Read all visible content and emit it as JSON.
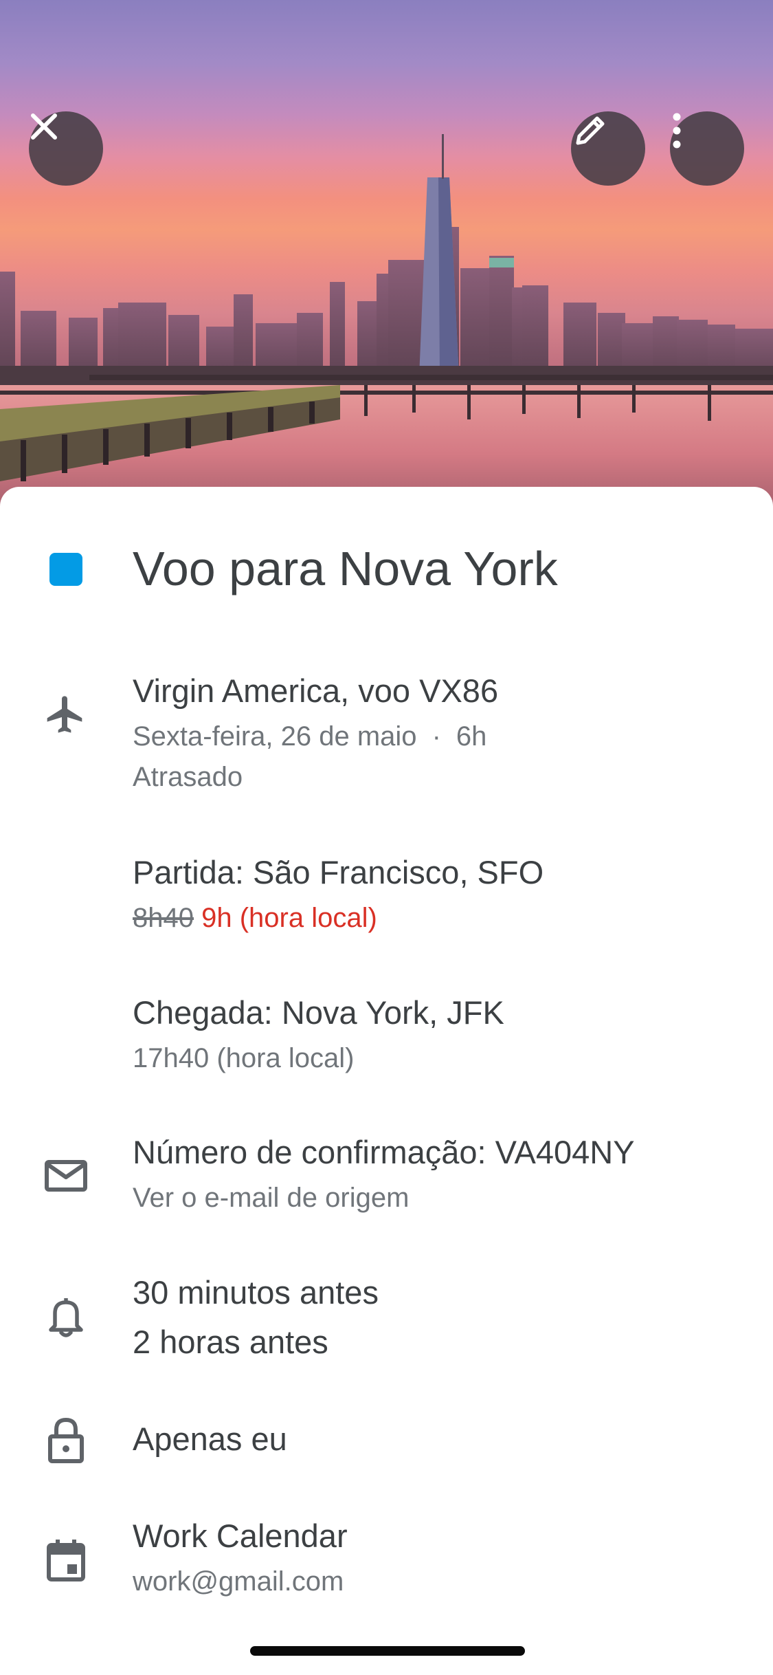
{
  "event": {
    "title": "Voo para Nova York",
    "calendar_color": "#039be5"
  },
  "flight": {
    "airline_line": "Virgin America, voo VX86",
    "date": "Sexta-feira, 26 de maio",
    "duration": "6h",
    "status": "Atrasado"
  },
  "departure": {
    "label": "Partida: São Francisco, SFO",
    "original_time": "8h40",
    "new_time": "9h (hora local)",
    "delay_color": "#d93025"
  },
  "arrival": {
    "label": "Chegada: Nova York, JFK",
    "time": "17h40 (hora local)"
  },
  "confirmation": {
    "label": "Número de confirmação: VA404NY",
    "link": "Ver o e-mail de origem"
  },
  "notifications": {
    "first": "30 minutos antes",
    "second": "2 horas antes"
  },
  "visibility": {
    "label": "Apenas eu"
  },
  "calendar": {
    "name": "Work Calendar",
    "account": "work@gmail.com"
  },
  "icons": {
    "close": "close-icon",
    "edit": "pencil-icon",
    "more": "more-vert-icon",
    "flight": "airplane-icon",
    "confirmation": "mail-icon",
    "notifications": "bell-icon",
    "visibility": "lock-icon",
    "calendar": "calendar-icon"
  }
}
